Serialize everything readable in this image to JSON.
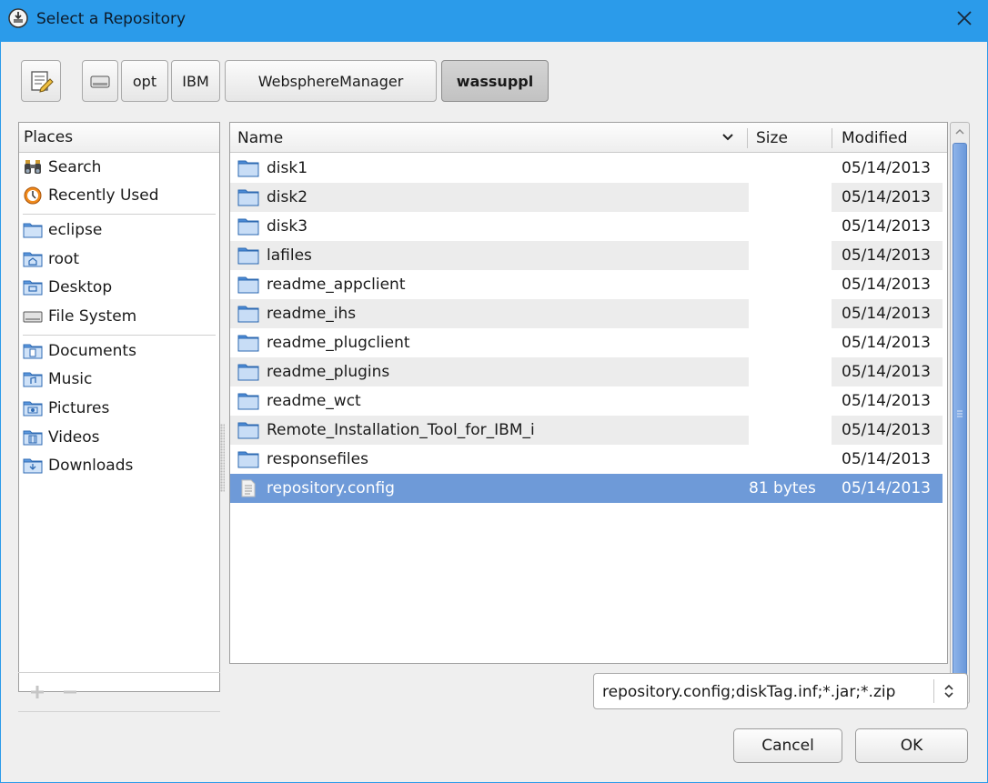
{
  "window": {
    "title": "Select a Repository"
  },
  "toolbar": {
    "path": [
      {
        "label": "opt",
        "active": false
      },
      {
        "label": "IBM",
        "active": false
      },
      {
        "label": "WebsphereManager",
        "active": false
      },
      {
        "label": "wassuppl",
        "active": true
      }
    ]
  },
  "places": {
    "header": "Places",
    "items": [
      {
        "label": "Search",
        "icon": "binoculars-icon"
      },
      {
        "label": "Recently Used",
        "icon": "recent-icon"
      },
      {
        "label": "eclipse",
        "icon": "folder-icon"
      },
      {
        "label": "root",
        "icon": "home-folder-icon"
      },
      {
        "label": "Desktop",
        "icon": "desktop-folder-icon"
      },
      {
        "label": "File System",
        "icon": "drive-icon"
      },
      {
        "label": "Documents",
        "icon": "documents-folder-icon"
      },
      {
        "label": "Music",
        "icon": "music-folder-icon"
      },
      {
        "label": "Pictures",
        "icon": "pictures-folder-icon"
      },
      {
        "label": "Videos",
        "icon": "videos-folder-icon"
      },
      {
        "label": "Downloads",
        "icon": "downloads-folder-icon"
      }
    ]
  },
  "files": {
    "columns": {
      "name": "Name",
      "size": "Size",
      "modified": "Modified"
    },
    "rows": [
      {
        "name": "disk1",
        "size": "",
        "modified": "05/14/2013",
        "type": "folder"
      },
      {
        "name": "disk2",
        "size": "",
        "modified": "05/14/2013",
        "type": "folder"
      },
      {
        "name": "disk3",
        "size": "",
        "modified": "05/14/2013",
        "type": "folder"
      },
      {
        "name": "lafiles",
        "size": "",
        "modified": "05/14/2013",
        "type": "folder"
      },
      {
        "name": "readme_appclient",
        "size": "",
        "modified": "05/14/2013",
        "type": "folder"
      },
      {
        "name": "readme_ihs",
        "size": "",
        "modified": "05/14/2013",
        "type": "folder"
      },
      {
        "name": "readme_plugclient",
        "size": "",
        "modified": "05/14/2013",
        "type": "folder"
      },
      {
        "name": "readme_plugins",
        "size": "",
        "modified": "05/14/2013",
        "type": "folder"
      },
      {
        "name": "readme_wct",
        "size": "",
        "modified": "05/14/2013",
        "type": "folder"
      },
      {
        "name": "Remote_Installation_Tool_for_IBM_i",
        "size": "",
        "modified": "05/14/2013",
        "type": "folder"
      },
      {
        "name": "responsefiles",
        "size": "",
        "modified": "05/14/2013",
        "type": "folder"
      },
      {
        "name": "repository.config",
        "size": "81 bytes",
        "modified": "05/14/2013",
        "type": "file",
        "selected": true
      }
    ]
  },
  "filter": {
    "value": "repository.config;diskTag.inf;*.jar;*.zip"
  },
  "buttons": {
    "cancel": "Cancel",
    "ok": "OK"
  },
  "colors": {
    "titlebar": "#2b9bea",
    "selection": "#6e9ad8",
    "scrollbar": "#6a98da"
  }
}
